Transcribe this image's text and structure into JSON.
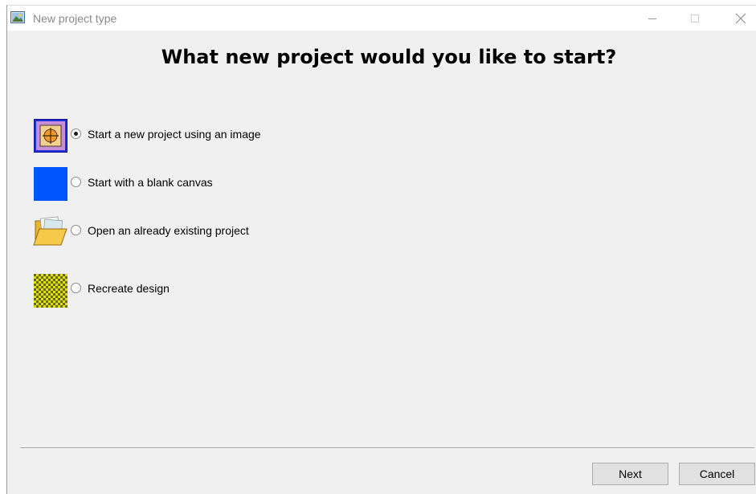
{
  "window": {
    "title": "New project type",
    "app_icon": "picture-icon",
    "controls": [
      "minimize-icon",
      "maximize-icon",
      "close-icon"
    ]
  },
  "heading": "What new project would you like to start?",
  "options": [
    {
      "label": "Start a new project using an image",
      "icon": "image-project-icon",
      "checked": true
    },
    {
      "label": "Start with a blank canvas",
      "icon": "blank-canvas-icon",
      "checked": false
    },
    {
      "label": "Open an already existing project",
      "icon": "folder-icon",
      "checked": false
    },
    {
      "label": "Recreate design",
      "icon": "checkerboard-icon",
      "checked": false
    }
  ],
  "buttons": {
    "next": "Next",
    "cancel": "Cancel"
  },
  "colors": {
    "window_bg": "#f0f0f0",
    "blank_canvas": "#0055ff",
    "checkerboard_a": "#e0e000",
    "checkerboard_b": "#6a6a10"
  }
}
